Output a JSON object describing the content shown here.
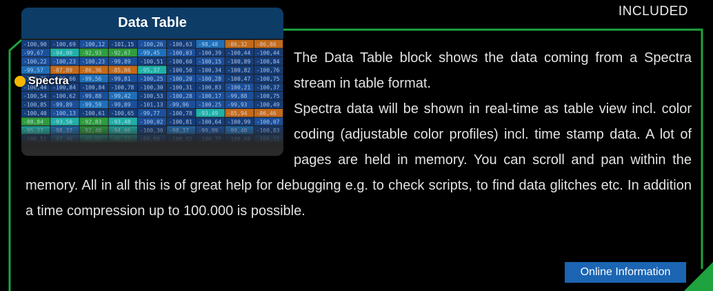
{
  "tag": "INCLUDED",
  "card": {
    "title": "Data Table",
    "badge": "Spectra"
  },
  "description": {
    "paragraphs": [
      "The Data Table block shows the data coming from a Spectra stream in table format.",
      "Spectra data will be shown in real-time as table view incl. color coding (adjustable color profiles) incl. time stamp data. A lot of pages are held in memory. You can scroll and pan within the memory. All in all this is of great help for debugging e.g. to check scripts, to find data glitches etc. In addition a time compression up to 100.000 is possible."
    ]
  },
  "online_button": "Online Information",
  "colors": {
    "frame": "#1fa33f",
    "header": "#0d3c66",
    "button": "#1b65b3",
    "badge_dot": "#f6b600"
  },
  "heat_rows": [
    [
      "-100,90",
      "-100,69",
      "-100,12",
      "-101,15",
      "-100,26",
      "-100,63",
      "-98,48",
      "-86,32",
      "-86,86"
    ],
    [
      "-99,67",
      "-94,00",
      "-92,93",
      "-92,67",
      "-99,45",
      "-100,03",
      "-100,39",
      "-100,44",
      "-100,44"
    ],
    [
      "-100,22",
      "-100,23",
      "-100,23",
      "-99,89",
      "-100,51",
      "-100,60",
      "-100,15",
      "-100,89",
      "-100,84"
    ],
    [
      "-99,57",
      "-87,89",
      "-86,36",
      "-85,86",
      "-95,37",
      "-100,50",
      "-100,34",
      "-100,82",
      "-100,76"
    ],
    [
      "-100,75",
      "-100,66",
      "-99,56",
      "-99,81",
      "-100,25",
      "-100,20",
      "-100,28",
      "-100,47",
      "-100,75"
    ],
    [
      "-100,44",
      "-100,84",
      "-100,84",
      "-100,78",
      "-100,30",
      "-100,31",
      "-100,83",
      "-100,21",
      "-100,37"
    ],
    [
      "-100,54",
      "-100,62",
      "-99,88",
      "-99,42",
      "-100,53",
      "-100,28",
      "-100,17",
      "-99,88",
      "-100,75"
    ],
    [
      "-100,85",
      "-99,89",
      "-99,59",
      "-99,89",
      "-101,13",
      "-99,96",
      "-100,25",
      "-99,93",
      "-100,49"
    ],
    [
      "-100,40",
      "-100,13",
      "-100,61",
      "-100,65",
      "-99,77",
      "-100,78",
      "-93,49",
      "-85,94",
      "-86,46"
    ],
    [
      "-88,84",
      "-93,50",
      "-92,83",
      "-93,48",
      "-100,02",
      "-100,81",
      "-100,64",
      "-100,99",
      "-100,07"
    ],
    [
      "-95,27",
      "-98,37",
      "-92,40",
      "-94,06",
      "-100,30",
      "-98,37",
      "-99,99",
      "-99,40",
      "-100,83"
    ],
    [
      "-100,51",
      "-97,40",
      "-95,02",
      "-96,13",
      "-99,80",
      "-100,92",
      "-100,75",
      "-100,68",
      "-100,21"
    ]
  ]
}
